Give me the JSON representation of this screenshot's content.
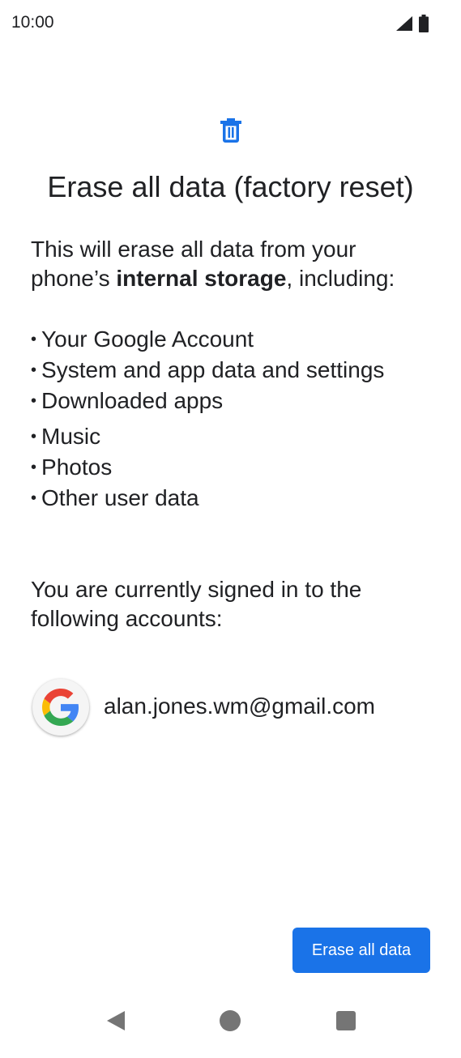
{
  "status_bar": {
    "time": "10:00",
    "icons": [
      "signal-icon",
      "battery-icon"
    ]
  },
  "header": {
    "icon": "trash-icon",
    "title": "Erase all data (factory reset)"
  },
  "intro": {
    "prefix": "This will erase all data from your phone’s ",
    "bold": "internal storage",
    "suffix": ", including:"
  },
  "items": [
    "Your Google Account",
    "System and app data and settings",
    "Downloaded apps",
    "Music",
    "Photos",
    "Other user data"
  ],
  "accounts": {
    "text": "You are currently signed in to the following accounts:",
    "list": [
      {
        "icon": "google-icon",
        "email": "alan.jones.wm@gmail.com"
      }
    ]
  },
  "action": {
    "erase_label": "Erase all data"
  },
  "colors": {
    "accent": "#1a73e8",
    "text": "#202124",
    "nav": "#757575"
  }
}
